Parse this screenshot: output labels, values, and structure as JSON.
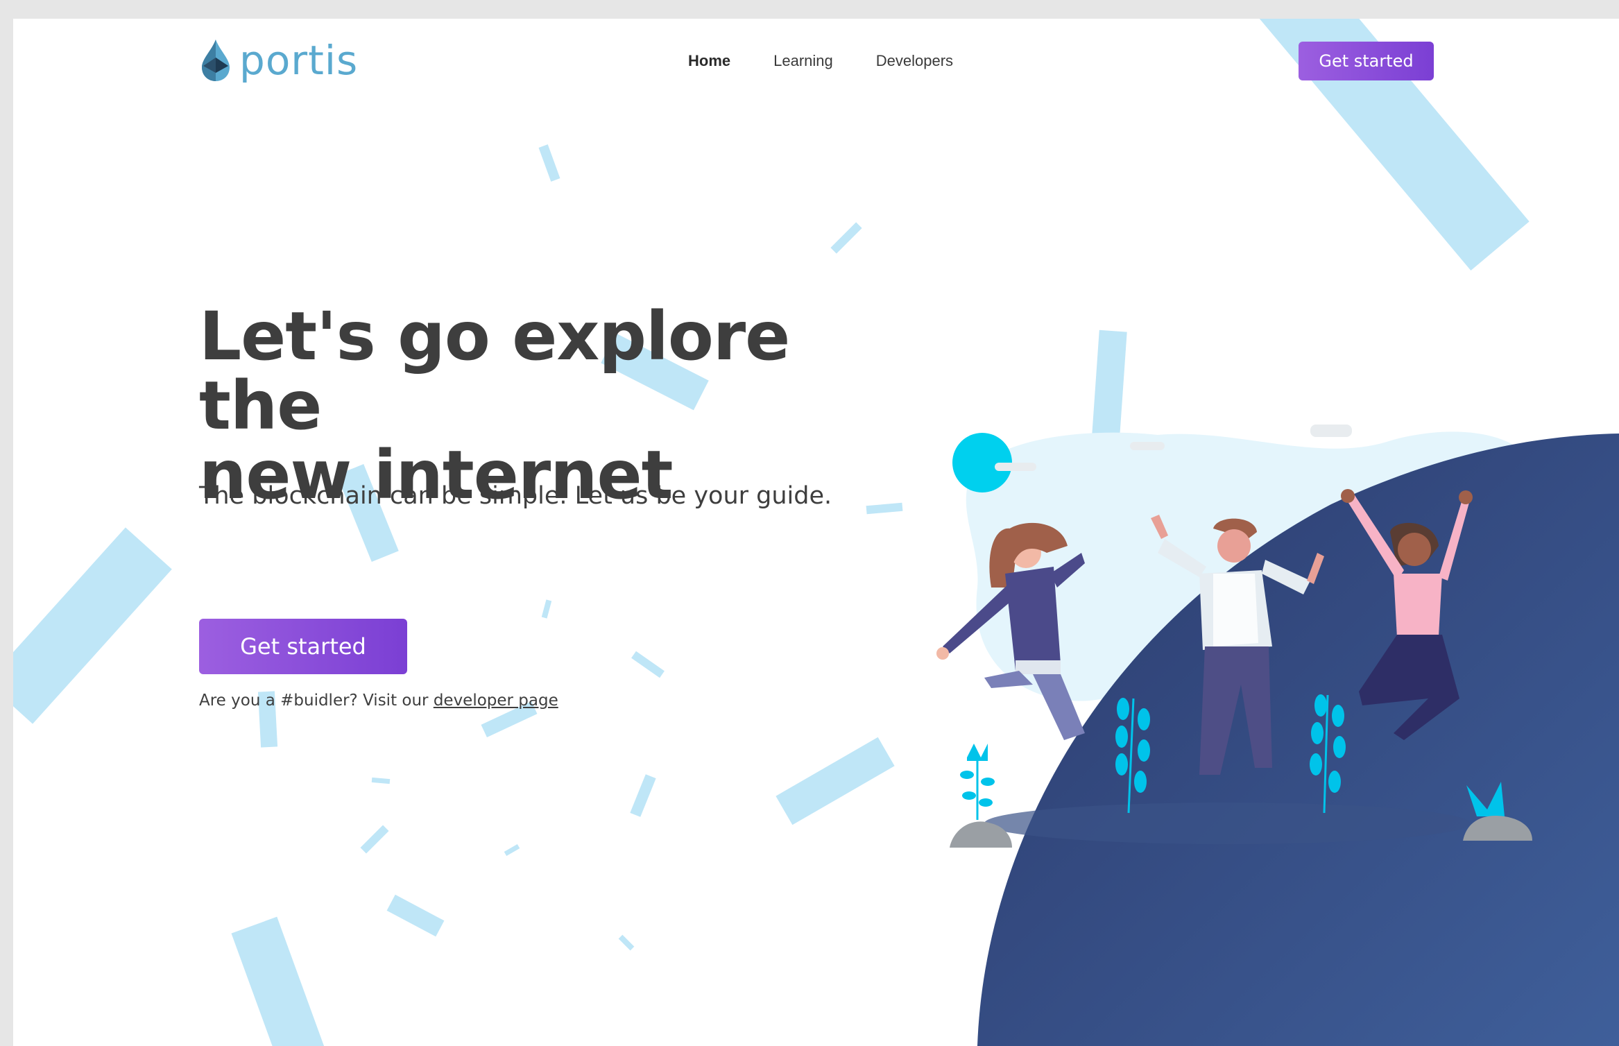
{
  "nav": {
    "logo_text": "portis",
    "links": [
      {
        "label": "Home",
        "active": true
      },
      {
        "label": "Learning",
        "active": false
      },
      {
        "label": "Developers",
        "active": false
      }
    ],
    "cta_label": "Get started"
  },
  "hero": {
    "title_line1": "Let's go explore the",
    "title_line2": "new internet",
    "subtitle": "The blockchain can be simple. Let us be your guide.",
    "cta_label": "Get started",
    "dev_prefix": "Are you a #buidler? Visit our ",
    "dev_link": "developer page"
  },
  "colors": {
    "brand": "#5aa9cf",
    "button_gradient_start": "#9c5fe0",
    "button_gradient_end": "#7b3fd4",
    "heading": "#3e3e3e",
    "confetti": "#bfe6f7",
    "planet": "#2c3f73"
  }
}
